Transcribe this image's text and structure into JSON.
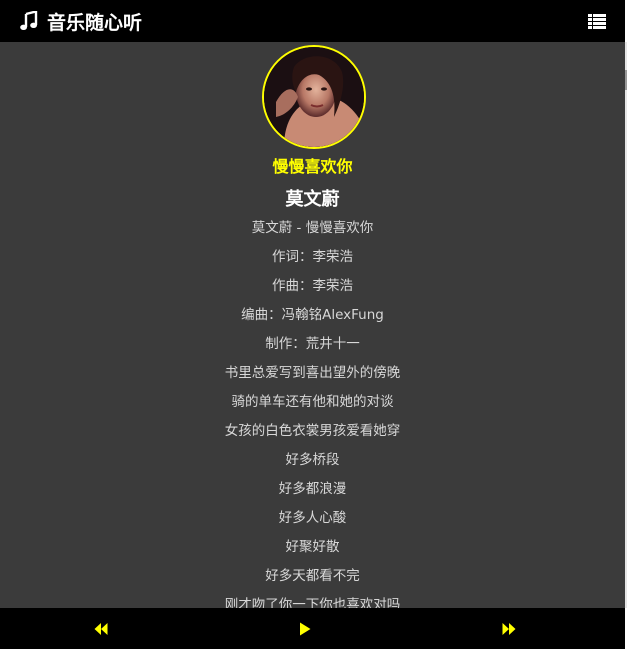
{
  "header": {
    "app_title": "音乐随心听",
    "brand_icon": "music-note-icon",
    "menu_icon": "list-menu-icon"
  },
  "now_playing": {
    "title": "慢慢喜欢你",
    "artist": "莫文蔚",
    "cover_icon": "album-cover-image"
  },
  "lyrics": [
    "莫文蔚 - 慢慢喜欢你",
    "作词：李荣浩",
    "作曲：李荣浩",
    "编曲：冯翰铭AlexFung",
    "制作：荒井十一",
    "书里总爱写到喜出望外的傍晚",
    "骑的单车还有他和她的对谈",
    "女孩的白色衣裳男孩爱看她穿",
    "好多桥段",
    "好多都浪漫",
    "好多人心酸",
    "好聚好散",
    "好多天都看不完",
    "刚才吻了你一下你也喜欢对吗"
  ],
  "controls": {
    "prev_icon": "previous-track-icon",
    "play_icon": "play-icon",
    "next_icon": "next-track-icon"
  },
  "colors": {
    "accent": "#ffff00",
    "header_bg": "#000000",
    "content_bg": "#3b3b3b",
    "lyric_text": "#d8d8d8"
  }
}
